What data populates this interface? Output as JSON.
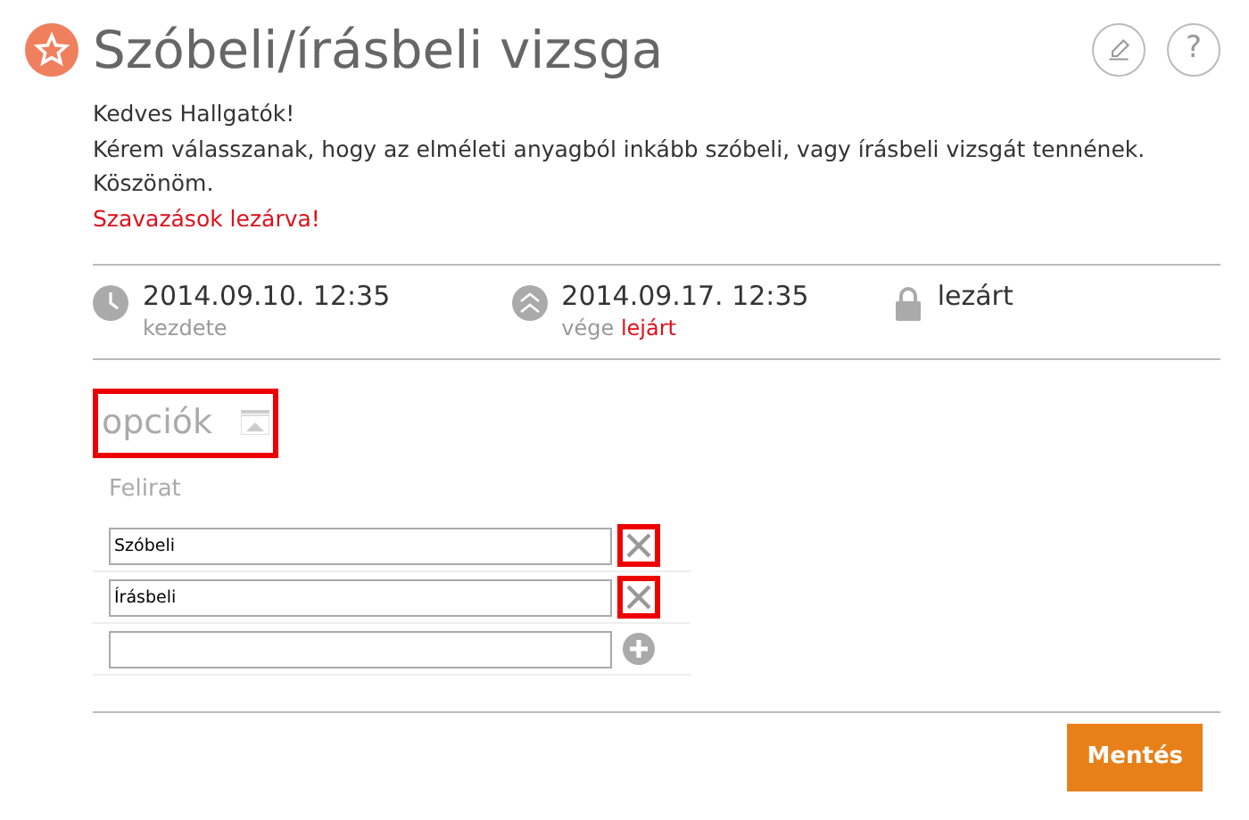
{
  "title": "Szóbeli/írásbeli vizsga",
  "help_button": "?",
  "description": [
    "Kedves Hallgatók!",
    "Kérem válasszanak, hogy az elméleti anyagból inkább szóbeli, vagy írásbeli vizsgát tennének.",
    "Köszönöm."
  ],
  "closed_notice": "Szavazások lezárva!",
  "dates": [
    {
      "kind": "start",
      "value": "2014.09.10. 12:35",
      "label": "kezdete"
    },
    {
      "kind": "end",
      "value": "2014.09.17. 12:35",
      "label": "vége",
      "status": "lejárt"
    },
    {
      "kind": "lock",
      "value": "lezárt"
    }
  ],
  "options": {
    "heading": "opciók",
    "highlighted": true,
    "column": "Felirat",
    "rows": [
      {
        "value": "Szóbeli",
        "kind": "remove",
        "highlighted": true
      },
      {
        "value": "Írásbeli",
        "kind": "remove",
        "highlighted": true
      },
      {
        "kind": "add",
        "highlighted": false
      }
    ]
  },
  "save_button": "Mentés"
}
